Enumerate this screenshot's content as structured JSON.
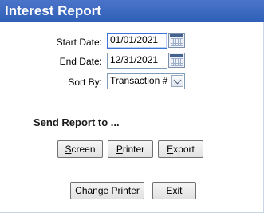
{
  "window": {
    "title": "Interest Report"
  },
  "form": {
    "start_date_label": "Start Date:",
    "start_date_value": "01/01/2021",
    "end_date_label": "End Date:",
    "end_date_value": "12/31/2021",
    "sort_by_label": "Sort By:",
    "sort_by_value": "Transaction #"
  },
  "send_report": {
    "heading": "Send Report to ...",
    "screen": {
      "mnemonic": "S",
      "rest": "creen"
    },
    "printer": {
      "mnemonic": "P",
      "rest": "rinter"
    },
    "export": {
      "mnemonic": "E",
      "rest": "xport"
    }
  },
  "footer": {
    "change_printer": {
      "mnemonic": "C",
      "rest": "hange Printer"
    },
    "exit": {
      "mnemonic": "E",
      "rest": "xit"
    }
  },
  "icons": {
    "calendar": "calendar-icon",
    "dropdown": "chevron-down-icon"
  },
  "colors": {
    "titlebar": "#3b68c0",
    "title_text": "#ffffff",
    "field_border": "#7f9db9"
  }
}
